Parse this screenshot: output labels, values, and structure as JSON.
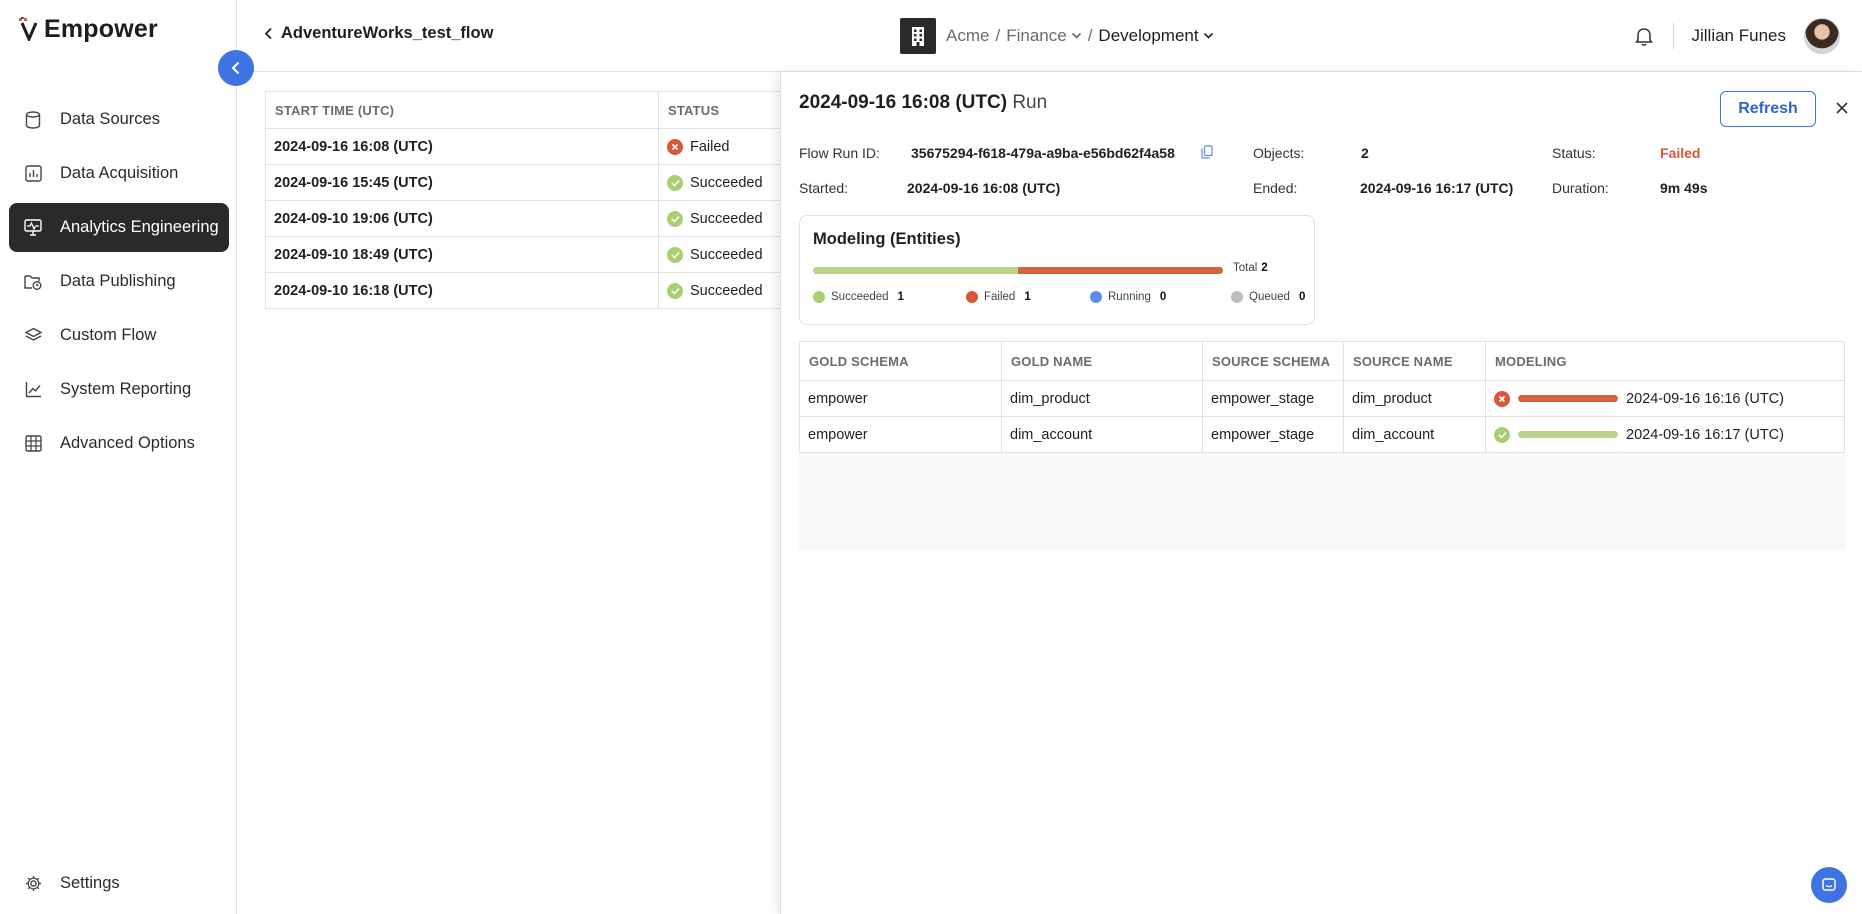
{
  "app": {
    "name": "Empower"
  },
  "sidebar": {
    "items": [
      {
        "label": "Data Sources",
        "icon": "database-icon"
      },
      {
        "label": "Data Acquisition",
        "icon": "chart-box-icon"
      },
      {
        "label": "Analytics Engineering",
        "icon": "monitor-pulse-icon",
        "active": true
      },
      {
        "label": "Data Publishing",
        "icon": "folder-clock-icon"
      },
      {
        "label": "Custom Flow",
        "icon": "layers-icon"
      },
      {
        "label": "System Reporting",
        "icon": "line-chart-icon"
      },
      {
        "label": "Advanced Options",
        "icon": "grid-icon"
      }
    ],
    "settings_label": "Settings"
  },
  "header": {
    "back_label": "AdventureWorks_test_flow",
    "crumbs": {
      "org": "Acme",
      "sep1": "/",
      "dept": "Finance",
      "sep2": "/",
      "env": "Development"
    },
    "user_name": "Jillian Funes"
  },
  "runs_table": {
    "columns": [
      "START TIME (UTC)",
      "STATUS"
    ],
    "rows": [
      {
        "time": "2024-09-16 16:08 (UTC)",
        "status": "Failed"
      },
      {
        "time": "2024-09-16 15:45 (UTC)",
        "status": "Succeeded"
      },
      {
        "time": "2024-09-10 19:06 (UTC)",
        "status": "Succeeded"
      },
      {
        "time": "2024-09-10 18:49 (UTC)",
        "status": "Succeeded"
      },
      {
        "time": "2024-09-10 16:18 (UTC)",
        "status": "Succeeded"
      }
    ]
  },
  "panel": {
    "title_time": "2024-09-16 16:08 (UTC)",
    "title_suffix": "Run",
    "refresh_label": "Refresh",
    "flow_run_id_label": "Flow Run ID:",
    "flow_run_id": "35675294-f618-479a-a9ba-e56bd62f4a58",
    "objects_label": "Objects:",
    "objects": "2",
    "status_label": "Status:",
    "status": "Failed",
    "started_label": "Started:",
    "started": "2024-09-16 16:08 (UTC)",
    "ended_label": "Ended:",
    "ended": "2024-09-16 16:17 (UTC)",
    "duration_label": "Duration:",
    "duration": "9m 49s",
    "modeling": {
      "title": "Modeling (Entities)",
      "total_label": "Total",
      "total": "2",
      "succeeded_fraction": 0.5,
      "failed_fraction": 0.5,
      "legend": [
        {
          "label": "Succeeded",
          "count": "1",
          "color": "#a9cf72"
        },
        {
          "label": "Failed",
          "count": "1",
          "color": "#d8573c"
        },
        {
          "label": "Running",
          "count": "0",
          "color": "#5b8def"
        },
        {
          "label": "Queued",
          "count": "0",
          "color": "#bdbdbd"
        }
      ]
    },
    "entities": {
      "columns": [
        "GOLD SCHEMA",
        "GOLD NAME",
        "SOURCE SCHEMA",
        "SOURCE NAME",
        "MODELING"
      ],
      "rows": [
        {
          "gold_schema": "empower",
          "gold_name": "dim_product",
          "source_schema": "empower_stage",
          "source_name": "dim_product",
          "status": "Failed",
          "time": "2024-09-16 16:16 (UTC)"
        },
        {
          "gold_schema": "empower",
          "gold_name": "dim_account",
          "source_schema": "empower_stage",
          "source_name": "dim_account",
          "status": "Succeeded",
          "time": "2024-09-16 16:17 (UTC)"
        }
      ]
    }
  },
  "colors": {
    "accent": "#3d73e3",
    "failed": "#d8573c",
    "succeeded": "#a9cf72",
    "active_nav": "#2a2a2c"
  }
}
